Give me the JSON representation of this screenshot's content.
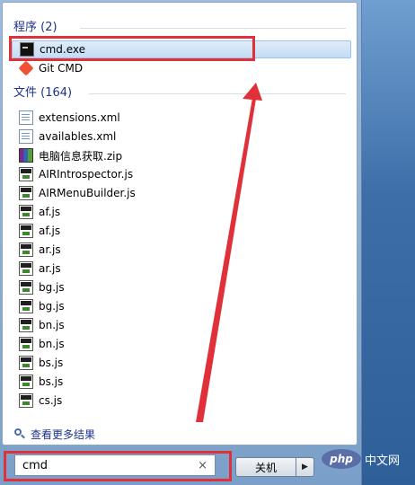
{
  "programs": {
    "header": "程序 (2)",
    "items": [
      {
        "label": "cmd.exe",
        "icon": "cmd-icon"
      },
      {
        "label": "Git CMD",
        "icon": "git-icon"
      }
    ]
  },
  "files": {
    "header": "文件 (164)",
    "items": [
      {
        "label": "extensions.xml",
        "icon": "xml-file-icon"
      },
      {
        "label": "availables.xml",
        "icon": "xml-file-icon"
      },
      {
        "label": "电脑信息获取.zip",
        "icon": "zip-file-icon"
      },
      {
        "label": "AIRIntrospector.js",
        "icon": "js-file-icon"
      },
      {
        "label": "AIRMenuBuilder.js",
        "icon": "js-file-icon"
      },
      {
        "label": "af.js",
        "icon": "js-file-icon"
      },
      {
        "label": "af.js",
        "icon": "js-file-icon"
      },
      {
        "label": "ar.js",
        "icon": "js-file-icon"
      },
      {
        "label": "ar.js",
        "icon": "js-file-icon"
      },
      {
        "label": "bg.js",
        "icon": "js-file-icon"
      },
      {
        "label": "bg.js",
        "icon": "js-file-icon"
      },
      {
        "label": "bn.js",
        "icon": "js-file-icon"
      },
      {
        "label": "bn.js",
        "icon": "js-file-icon"
      },
      {
        "label": "bs.js",
        "icon": "js-file-icon"
      },
      {
        "label": "bs.js",
        "icon": "js-file-icon"
      },
      {
        "label": "cs.js",
        "icon": "js-file-icon"
      }
    ]
  },
  "see_more": "查看更多结果",
  "search": {
    "value": "cmd",
    "clear_label": "×"
  },
  "shutdown": {
    "label": "关机",
    "arrow": "▶"
  },
  "watermark": {
    "logo": "php",
    "text": "中文网"
  },
  "colors": {
    "annotation": "#e0313a",
    "header_text": "#1e3287"
  }
}
